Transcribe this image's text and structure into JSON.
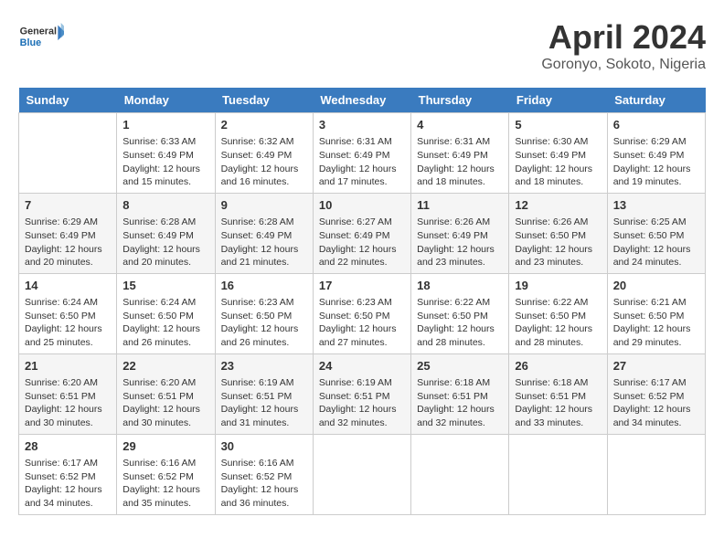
{
  "logo": {
    "line1": "General",
    "line2": "Blue"
  },
  "title": "April 2024",
  "subtitle": "Goronyo, Sokoto, Nigeria",
  "days_header": [
    "Sunday",
    "Monday",
    "Tuesday",
    "Wednesday",
    "Thursday",
    "Friday",
    "Saturday"
  ],
  "weeks": [
    [
      {
        "day": "",
        "info": ""
      },
      {
        "day": "1",
        "info": "Sunrise: 6:33 AM\nSunset: 6:49 PM\nDaylight: 12 hours\nand 15 minutes."
      },
      {
        "day": "2",
        "info": "Sunrise: 6:32 AM\nSunset: 6:49 PM\nDaylight: 12 hours\nand 16 minutes."
      },
      {
        "day": "3",
        "info": "Sunrise: 6:31 AM\nSunset: 6:49 PM\nDaylight: 12 hours\nand 17 minutes."
      },
      {
        "day": "4",
        "info": "Sunrise: 6:31 AM\nSunset: 6:49 PM\nDaylight: 12 hours\nand 18 minutes."
      },
      {
        "day": "5",
        "info": "Sunrise: 6:30 AM\nSunset: 6:49 PM\nDaylight: 12 hours\nand 18 minutes."
      },
      {
        "day": "6",
        "info": "Sunrise: 6:29 AM\nSunset: 6:49 PM\nDaylight: 12 hours\nand 19 minutes."
      }
    ],
    [
      {
        "day": "7",
        "info": "Sunrise: 6:29 AM\nSunset: 6:49 PM\nDaylight: 12 hours\nand 20 minutes."
      },
      {
        "day": "8",
        "info": "Sunrise: 6:28 AM\nSunset: 6:49 PM\nDaylight: 12 hours\nand 20 minutes."
      },
      {
        "day": "9",
        "info": "Sunrise: 6:28 AM\nSunset: 6:49 PM\nDaylight: 12 hours\nand 21 minutes."
      },
      {
        "day": "10",
        "info": "Sunrise: 6:27 AM\nSunset: 6:49 PM\nDaylight: 12 hours\nand 22 minutes."
      },
      {
        "day": "11",
        "info": "Sunrise: 6:26 AM\nSunset: 6:49 PM\nDaylight: 12 hours\nand 23 minutes."
      },
      {
        "day": "12",
        "info": "Sunrise: 6:26 AM\nSunset: 6:50 PM\nDaylight: 12 hours\nand 23 minutes."
      },
      {
        "day": "13",
        "info": "Sunrise: 6:25 AM\nSunset: 6:50 PM\nDaylight: 12 hours\nand 24 minutes."
      }
    ],
    [
      {
        "day": "14",
        "info": "Sunrise: 6:24 AM\nSunset: 6:50 PM\nDaylight: 12 hours\nand 25 minutes."
      },
      {
        "day": "15",
        "info": "Sunrise: 6:24 AM\nSunset: 6:50 PM\nDaylight: 12 hours\nand 26 minutes."
      },
      {
        "day": "16",
        "info": "Sunrise: 6:23 AM\nSunset: 6:50 PM\nDaylight: 12 hours\nand 26 minutes."
      },
      {
        "day": "17",
        "info": "Sunrise: 6:23 AM\nSunset: 6:50 PM\nDaylight: 12 hours\nand 27 minutes."
      },
      {
        "day": "18",
        "info": "Sunrise: 6:22 AM\nSunset: 6:50 PM\nDaylight: 12 hours\nand 28 minutes."
      },
      {
        "day": "19",
        "info": "Sunrise: 6:22 AM\nSunset: 6:50 PM\nDaylight: 12 hours\nand 28 minutes."
      },
      {
        "day": "20",
        "info": "Sunrise: 6:21 AM\nSunset: 6:50 PM\nDaylight: 12 hours\nand 29 minutes."
      }
    ],
    [
      {
        "day": "21",
        "info": "Sunrise: 6:20 AM\nSunset: 6:51 PM\nDaylight: 12 hours\nand 30 minutes."
      },
      {
        "day": "22",
        "info": "Sunrise: 6:20 AM\nSunset: 6:51 PM\nDaylight: 12 hours\nand 30 minutes."
      },
      {
        "day": "23",
        "info": "Sunrise: 6:19 AM\nSunset: 6:51 PM\nDaylight: 12 hours\nand 31 minutes."
      },
      {
        "day": "24",
        "info": "Sunrise: 6:19 AM\nSunset: 6:51 PM\nDaylight: 12 hours\nand 32 minutes."
      },
      {
        "day": "25",
        "info": "Sunrise: 6:18 AM\nSunset: 6:51 PM\nDaylight: 12 hours\nand 32 minutes."
      },
      {
        "day": "26",
        "info": "Sunrise: 6:18 AM\nSunset: 6:51 PM\nDaylight: 12 hours\nand 33 minutes."
      },
      {
        "day": "27",
        "info": "Sunrise: 6:17 AM\nSunset: 6:52 PM\nDaylight: 12 hours\nand 34 minutes."
      }
    ],
    [
      {
        "day": "28",
        "info": "Sunrise: 6:17 AM\nSunset: 6:52 PM\nDaylight: 12 hours\nand 34 minutes."
      },
      {
        "day": "29",
        "info": "Sunrise: 6:16 AM\nSunset: 6:52 PM\nDaylight: 12 hours\nand 35 minutes."
      },
      {
        "day": "30",
        "info": "Sunrise: 6:16 AM\nSunset: 6:52 PM\nDaylight: 12 hours\nand 36 minutes."
      },
      {
        "day": "",
        "info": ""
      },
      {
        "day": "",
        "info": ""
      },
      {
        "day": "",
        "info": ""
      },
      {
        "day": "",
        "info": ""
      }
    ]
  ]
}
